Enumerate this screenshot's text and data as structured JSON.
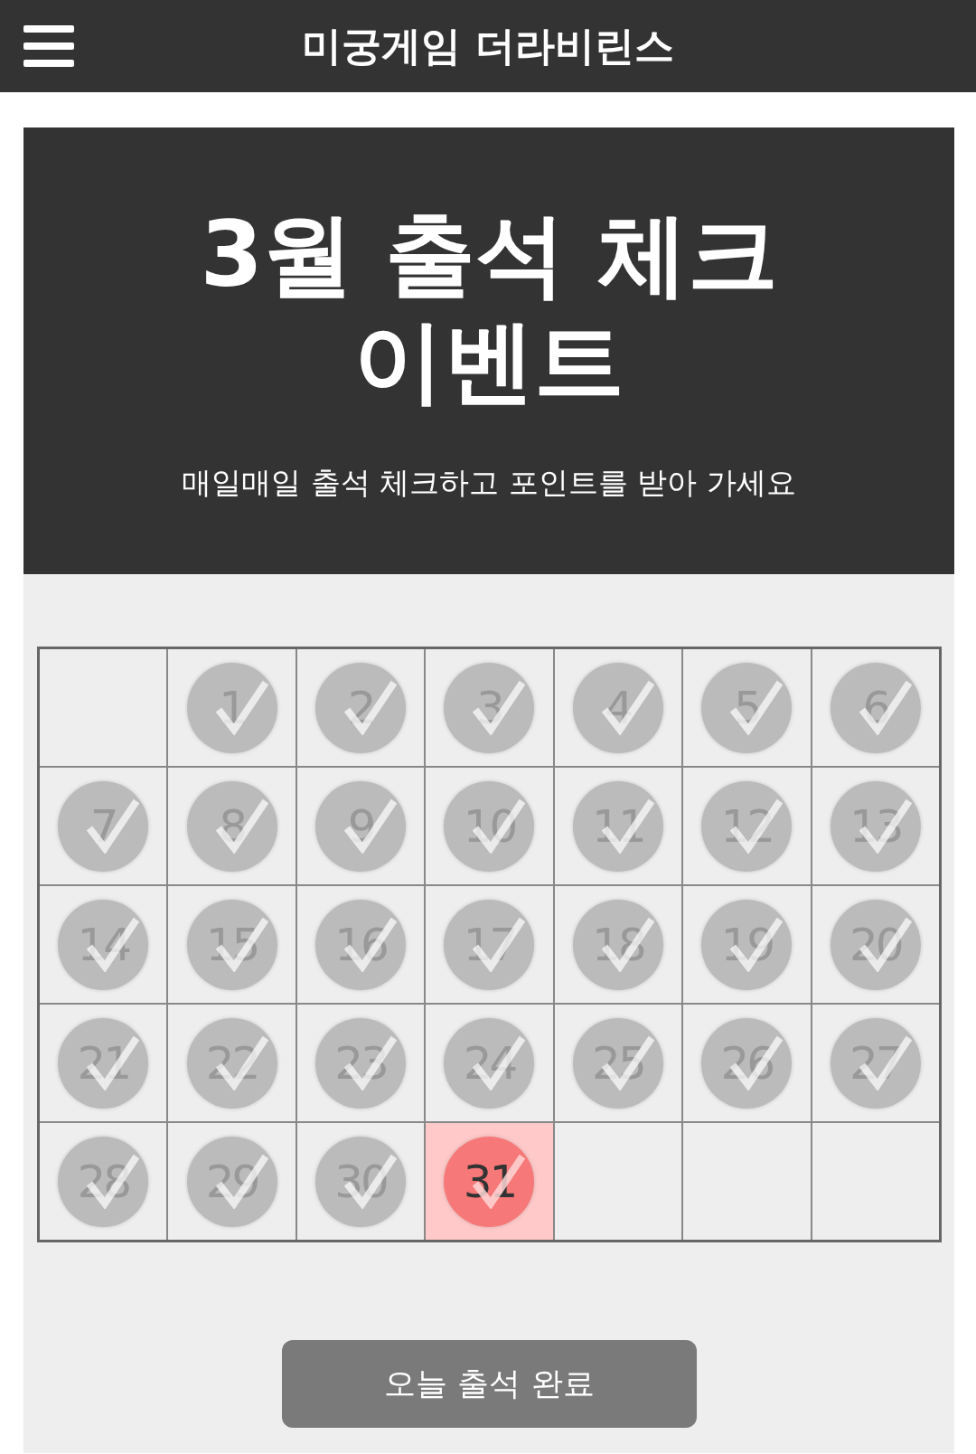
{
  "header": {
    "title": "미궁게임 더라비린스"
  },
  "hero": {
    "title_lines": [
      "3월 출석 체크",
      "이벤트"
    ],
    "subtitle": "매일매일 출석 체크하고 포인트를 받아 가세요"
  },
  "calendar": {
    "days": [
      {
        "kind": "blank"
      },
      {
        "kind": "day",
        "label": "1",
        "checked": true,
        "today": false
      },
      {
        "kind": "day",
        "label": "2",
        "checked": true,
        "today": false
      },
      {
        "kind": "day",
        "label": "3",
        "checked": true,
        "today": false
      },
      {
        "kind": "day",
        "label": "4",
        "checked": true,
        "today": false
      },
      {
        "kind": "day",
        "label": "5",
        "checked": true,
        "today": false
      },
      {
        "kind": "day",
        "label": "6",
        "checked": true,
        "today": false
      },
      {
        "kind": "day",
        "label": "7",
        "checked": true,
        "today": false
      },
      {
        "kind": "day",
        "label": "8",
        "checked": true,
        "today": false
      },
      {
        "kind": "day",
        "label": "9",
        "checked": true,
        "today": false
      },
      {
        "kind": "day",
        "label": "10",
        "checked": true,
        "today": false
      },
      {
        "kind": "day",
        "label": "11",
        "checked": true,
        "today": false
      },
      {
        "kind": "day",
        "label": "12",
        "checked": true,
        "today": false
      },
      {
        "kind": "day",
        "label": "13",
        "checked": true,
        "today": false
      },
      {
        "kind": "day",
        "label": "14",
        "checked": true,
        "today": false
      },
      {
        "kind": "day",
        "label": "15",
        "checked": true,
        "today": false
      },
      {
        "kind": "day",
        "label": "16",
        "checked": true,
        "today": false
      },
      {
        "kind": "day",
        "label": "17",
        "checked": true,
        "today": false
      },
      {
        "kind": "day",
        "label": "18",
        "checked": true,
        "today": false
      },
      {
        "kind": "day",
        "label": "19",
        "checked": true,
        "today": false
      },
      {
        "kind": "day",
        "label": "20",
        "checked": true,
        "today": false
      },
      {
        "kind": "day",
        "label": "21",
        "checked": true,
        "today": false
      },
      {
        "kind": "day",
        "label": "22",
        "checked": true,
        "today": false
      },
      {
        "kind": "day",
        "label": "23",
        "checked": true,
        "today": false
      },
      {
        "kind": "day",
        "label": "24",
        "checked": true,
        "today": false
      },
      {
        "kind": "day",
        "label": "25",
        "checked": true,
        "today": false
      },
      {
        "kind": "day",
        "label": "26",
        "checked": true,
        "today": false
      },
      {
        "kind": "day",
        "label": "27",
        "checked": true,
        "today": false
      },
      {
        "kind": "day",
        "label": "28",
        "checked": true,
        "today": false
      },
      {
        "kind": "day",
        "label": "29",
        "checked": true,
        "today": false
      },
      {
        "kind": "day",
        "label": "30",
        "checked": true,
        "today": false
      },
      {
        "kind": "day",
        "label": "31",
        "checked": true,
        "today": true
      },
      {
        "kind": "blank"
      },
      {
        "kind": "blank"
      },
      {
        "kind": "blank"
      }
    ]
  },
  "button": {
    "label": "오늘 출석 완료"
  }
}
